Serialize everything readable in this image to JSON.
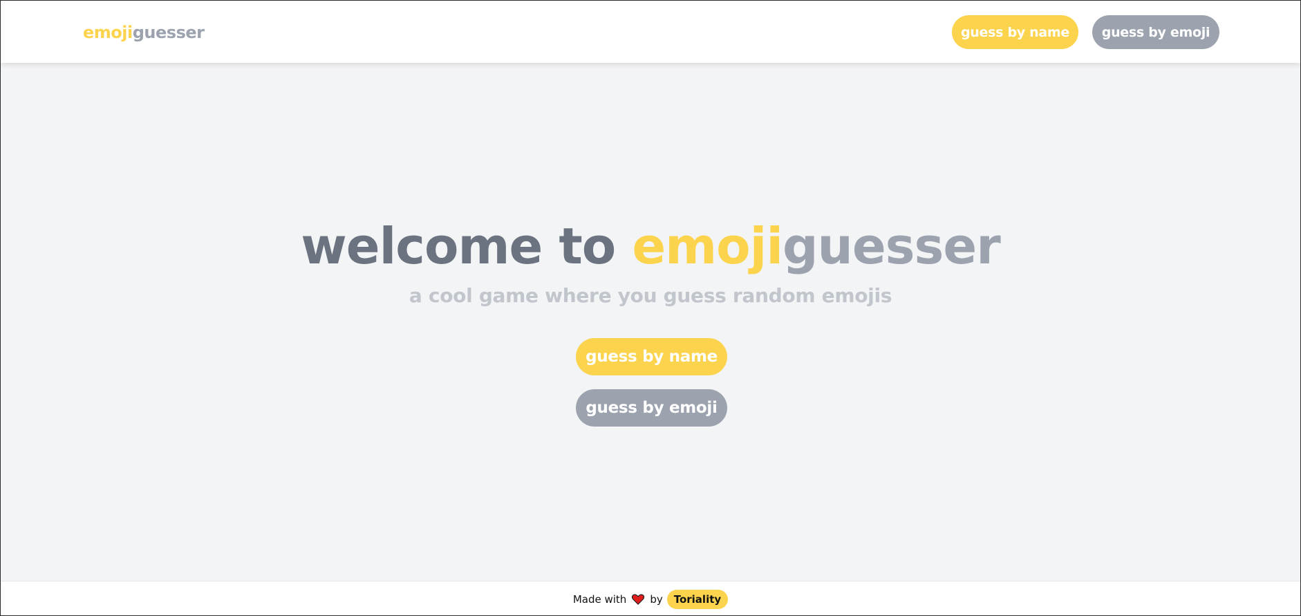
{
  "header": {
    "logo": {
      "part1": "emoji",
      "part2": "guesser"
    },
    "nav": {
      "guess_by_name": "guess by name",
      "guess_by_emoji": "guess by emoji"
    }
  },
  "hero": {
    "title_prefix": "welcome to ",
    "title_part1": "emoji",
    "title_part2": "guesser",
    "subtitle": "a cool game where you guess random emojis",
    "buttons": {
      "guess_by_name": "guess by name",
      "guess_by_emoji": "guess by emoji"
    }
  },
  "footer": {
    "made_with": "Made with",
    "heart_icon": "heart-icon",
    "by": "by",
    "author": "Toriality"
  },
  "colors": {
    "accent_yellow": "#fcd34d",
    "accent_gray": "#9ca3af",
    "title_dark": "#6b7280",
    "subtitle": "#c1c5cc",
    "background": "#f3f4f6",
    "heart": "#e11d1d"
  }
}
